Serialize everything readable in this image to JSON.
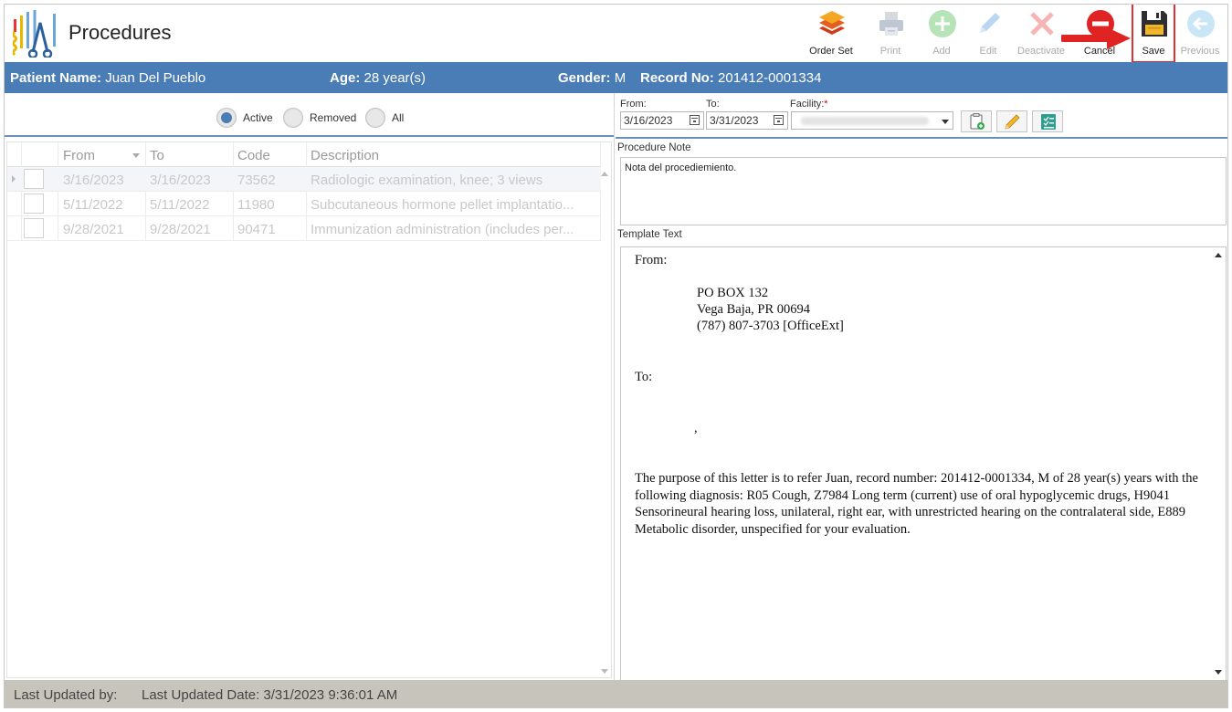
{
  "header": {
    "title": "Procedures",
    "toolbar": [
      {
        "id": "order_set",
        "label": "Order Set",
        "icon": "layers-icon",
        "enabled": true
      },
      {
        "id": "print",
        "label": "Print",
        "icon": "printer-icon",
        "enabled": false
      },
      {
        "id": "add",
        "label": "Add",
        "icon": "plus-circle-icon",
        "enabled": false
      },
      {
        "id": "edit",
        "label": "Edit",
        "icon": "pencil-icon",
        "enabled": false
      },
      {
        "id": "deactivate",
        "label": "Deactivate",
        "icon": "x-icon",
        "enabled": false
      },
      {
        "id": "cancel",
        "label": "Cancel",
        "icon": "no-entry-icon",
        "enabled": true
      },
      {
        "id": "save",
        "label": "Save",
        "icon": "floppy-disk-icon",
        "enabled": true
      },
      {
        "id": "previous",
        "label": "Previous",
        "icon": "arrow-left-circle-icon",
        "enabled": false
      }
    ]
  },
  "patient": {
    "name_label": "Patient Name:",
    "name": "Juan Del Pueblo",
    "age_label": "Age:",
    "age": "28 year(s)",
    "gender_label": "Gender:",
    "gender": "M",
    "record_label": "Record No:",
    "record": "201412-0001334"
  },
  "filters": {
    "status_options": [
      {
        "label": "Active",
        "selected": true
      },
      {
        "label": "Removed",
        "selected": false
      },
      {
        "label": "All",
        "selected": false
      }
    ],
    "from_label": "From:",
    "from_value": "3/16/2023",
    "to_label": "To:",
    "to_value": "3/31/2023",
    "facility_label": "Facility:",
    "facility_required": "*"
  },
  "grid": {
    "columns": [
      "From",
      "To",
      "Code",
      "Description"
    ],
    "rows": [
      {
        "from": "3/16/2023",
        "to": "3/16/2023",
        "code": "73562",
        "description": "Radiologic examination, knee; 3 views"
      },
      {
        "from": "5/11/2022",
        "to": "5/11/2022",
        "code": "11980",
        "description": "Subcutaneous hormone pellet implantatio..."
      },
      {
        "from": "9/28/2021",
        "to": "9/28/2021",
        "code": "90471",
        "description": "Immunization administration (includes per..."
      }
    ]
  },
  "procedure_note": {
    "label": "Procedure Note",
    "value": "Nota del procediemiento."
  },
  "template": {
    "label": "Template Text",
    "from_label": "From:",
    "address_line1": "PO BOX 132",
    "address_line2": "Vega Baja, PR 00694",
    "address_line3": "(787) 807-3703 [OfficeExt]",
    "to_label": "To:",
    "comma": ",",
    "body": "The purpose of this letter is to refer Juan,  record number: 201412-0001334,  M of 28 year(s) years with the following diagnosis: R05 Cough, Z7984 Long term (current) use of oral hypoglycemic drugs, H9041 Sensorineural hearing loss, unilateral, right ear, with unrestricted hearing on the contralateral side, E889 Metabolic disorder, unspecified  for your evaluation."
  },
  "status_bar": {
    "updated_by": "Last Updated by:",
    "updated_date": "Last Updated Date: 3/31/2023 9:36:01 AM"
  },
  "colors": {
    "patient_bar": "#4a7db5",
    "status_bar": "#c7c5bb",
    "highlight": "#e03030"
  }
}
